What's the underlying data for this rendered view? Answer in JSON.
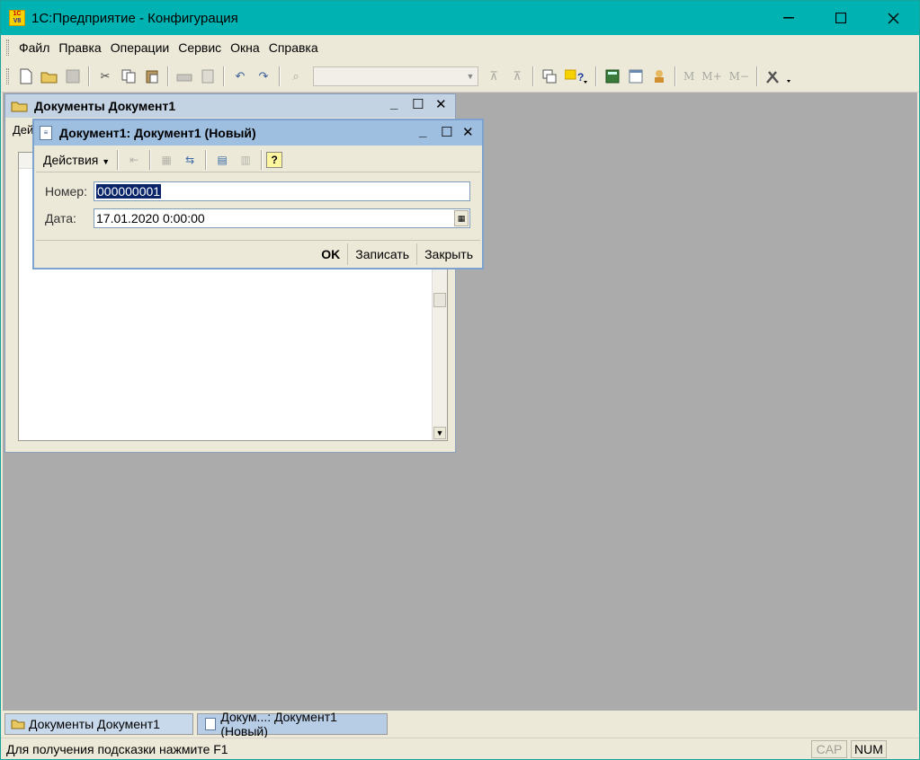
{
  "app": {
    "title": "1С:Предприятие - Конфигурация",
    "logo_top": "1С",
    "logo_bottom": "V8"
  },
  "menu": {
    "items": [
      "Файл",
      "Правка",
      "Операции",
      "Сервис",
      "Окна",
      "Справка"
    ],
    "underline_letters": [
      "Ф",
      "П",
      "О",
      "С",
      "О",
      "С"
    ]
  },
  "toolbar": {
    "icons": [
      "new-doc",
      "open",
      "save",
      "cut",
      "copy",
      "paste",
      "print",
      "preview",
      "undo",
      "redo",
      "find",
      "find-next",
      "find-prev",
      "windows",
      "help-1c",
      "calculator",
      "calendar",
      "user-tools",
      "memory-store",
      "memory-add",
      "memory-subtract",
      "settings"
    ],
    "memory_labels": [
      "M",
      "M+",
      "M−"
    ],
    "search_value": ""
  },
  "list_window": {
    "title": "Документы Документ1",
    "toolbar_fragment": "Дей"
  },
  "doc_window": {
    "title": "Документ1: Документ1 (Новый)",
    "actions_label": "Действия",
    "number_label": "Номер:",
    "number_value": "000000001",
    "date_label": "Дата:",
    "date_value": "17.01.2020  0:00:00",
    "ok_label": "OK",
    "save_label": "Записать",
    "close_label": "Закрыть"
  },
  "window_bar": {
    "tabs": [
      "Документы Документ1",
      "Докум...: Документ1 (Новый)"
    ]
  },
  "status": {
    "hint": "Для получения подсказки нажмите F1",
    "cap": "CAP",
    "num": "NUM"
  },
  "colors": {
    "titlebar": "#00b2b2",
    "workspace": "#ababab",
    "selection": "#0a246a"
  }
}
